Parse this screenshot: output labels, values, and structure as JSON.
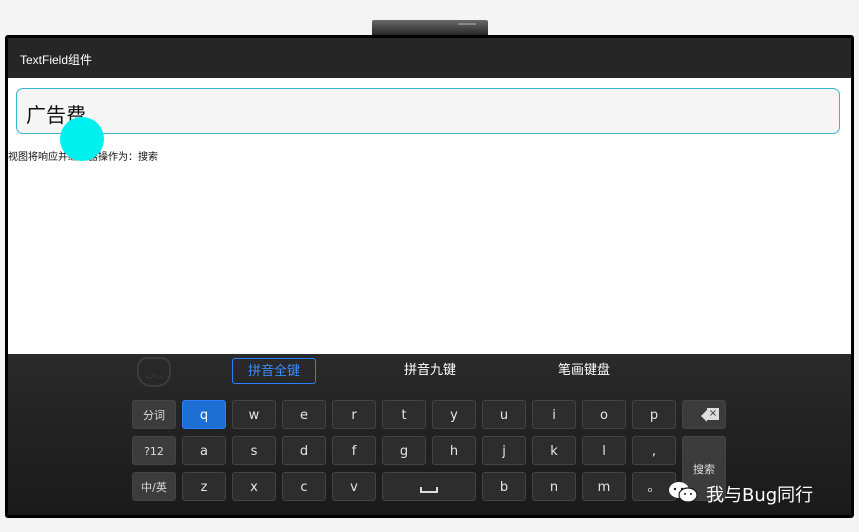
{
  "appbar": {
    "title": "TextField组件"
  },
  "textfield": {
    "value": "广告费"
  },
  "action_text": "视图将响应并编辑器操作为：搜索",
  "keyboard": {
    "modes": [
      {
        "label": "拼音全键",
        "active": true
      },
      {
        "label": "拼音九键",
        "active": false
      },
      {
        "label": "笔画键盘",
        "active": false
      }
    ],
    "keys": {
      "fenci": "分词",
      "num": "?12",
      "lang": "中/英",
      "search": "搜索",
      "comma": ",",
      "period": "。",
      "row1": [
        "q",
        "w",
        "e",
        "r",
        "t",
        "y",
        "u",
        "i",
        "o",
        "p"
      ],
      "row2": [
        "a",
        "s",
        "d",
        "f",
        "g",
        "h",
        "j",
        "k",
        "l"
      ],
      "row3": [
        "z",
        "x",
        "c",
        "v",
        "b",
        "n",
        "m"
      ]
    },
    "colors": {
      "accent": "#2a7fff",
      "highlight_key": "#1e6fd4"
    }
  },
  "overlay": {
    "touch_indicator_color": "#00f0f0"
  },
  "watermark": {
    "text": "我与Bug同行"
  }
}
